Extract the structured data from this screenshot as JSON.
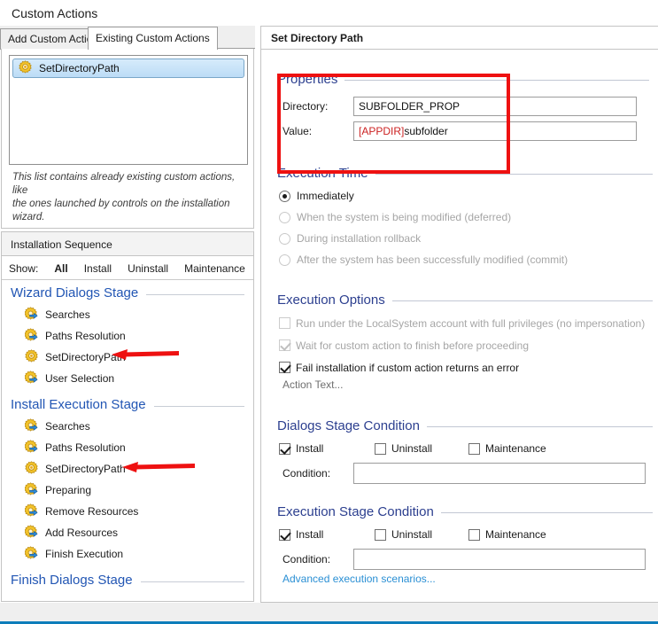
{
  "window": {
    "title": "Custom Actions"
  },
  "left": {
    "tabs": [
      {
        "label": "Add Custom Action",
        "selected": false
      },
      {
        "label": "Existing Custom Actions",
        "selected": true
      }
    ],
    "list": {
      "items": [
        {
          "label": "SetDirectoryPath",
          "icon": "gear-icon",
          "selected": true
        }
      ],
      "help_line1": "This list contains already existing custom actions, like",
      "help_line2": "the ones launched by controls on the installation wizard."
    },
    "sequence": {
      "header": "Installation Sequence",
      "show_label": "Show:",
      "filters": [
        {
          "label": "All",
          "active": true
        },
        {
          "label": "Install",
          "active": false
        },
        {
          "label": "Uninstall",
          "active": false
        },
        {
          "label": "Maintenance",
          "active": false
        }
      ],
      "stages": [
        {
          "title": "Wizard Dialogs Stage",
          "items": [
            {
              "label": "Searches",
              "icon": "gear-arrow-icon",
              "arrow": false
            },
            {
              "label": "Paths Resolution",
              "icon": "gear-arrow-icon",
              "arrow": false
            },
            {
              "label": "SetDirectoryPath",
              "icon": "gear-icon",
              "arrow": true
            },
            {
              "label": "User Selection",
              "icon": "gear-arrow-icon",
              "arrow": false
            }
          ]
        },
        {
          "title": "Install Execution Stage",
          "items": [
            {
              "label": "Searches",
              "icon": "gear-arrow-icon",
              "arrow": false
            },
            {
              "label": "Paths Resolution",
              "icon": "gear-arrow-icon",
              "arrow": false
            },
            {
              "label": "SetDirectoryPath",
              "icon": "gear-icon",
              "arrow": true
            },
            {
              "label": "Preparing",
              "icon": "gear-arrow-icon",
              "arrow": false
            },
            {
              "label": "Remove Resources",
              "icon": "gear-arrow-icon",
              "arrow": false
            },
            {
              "label": "Add Resources",
              "icon": "gear-arrow-icon",
              "arrow": false
            },
            {
              "label": "Finish Execution",
              "icon": "gear-arrow-icon",
              "arrow": false
            }
          ]
        },
        {
          "title": "Finish Dialogs Stage",
          "items": []
        }
      ]
    }
  },
  "right": {
    "title": "Set Directory Path",
    "properties": {
      "heading": "Properties",
      "directory_label": "Directory:",
      "directory_value": "SUBFOLDER_PROP",
      "value_label": "Value:",
      "value_prefix": "[APPDIR]",
      "value_suffix": "subfolder"
    },
    "execution_time": {
      "heading": "Execution Time",
      "options": [
        {
          "label": "Immediately",
          "selected": true,
          "disabled": false
        },
        {
          "label": "When the system is being modified (deferred)",
          "selected": false,
          "disabled": true
        },
        {
          "label": "During installation rollback",
          "selected": false,
          "disabled": true
        },
        {
          "label": "After the system has been successfully modified (commit)",
          "selected": false,
          "disabled": true
        }
      ]
    },
    "execution_options": {
      "heading": "Execution Options",
      "options": [
        {
          "label": "Run under the LocalSystem account with full privileges (no impersonation)",
          "checked": false,
          "disabled": true
        },
        {
          "label": "Wait for custom action to finish before proceeding",
          "checked": true,
          "disabled": true
        },
        {
          "label": "Fail installation if custom action returns an error",
          "checked": true,
          "disabled": false
        }
      ],
      "action_text": "Action Text..."
    },
    "dialogs_stage_condition": {
      "heading": "Dialogs Stage Condition",
      "install": {
        "label": "Install",
        "checked": true
      },
      "uninstall": {
        "label": "Uninstall",
        "checked": false
      },
      "maintenance": {
        "label": "Maintenance",
        "checked": false
      },
      "condition_label": "Condition:",
      "condition_value": ""
    },
    "execution_stage_condition": {
      "heading": "Execution Stage Condition",
      "install": {
        "label": "Install",
        "checked": true
      },
      "uninstall": {
        "label": "Uninstall",
        "checked": false
      },
      "maintenance": {
        "label": "Maintenance",
        "checked": false
      },
      "condition_label": "Condition:",
      "condition_value": "",
      "advanced_link": "Advanced execution scenarios..."
    }
  },
  "colors": {
    "annotation": "#ee1111",
    "group_heading": "#2c3f8f",
    "stage_heading": "#2256b4",
    "link": "#2a8fd4",
    "footer_accent": "#0d7dba",
    "property_token": "#cc2222"
  }
}
